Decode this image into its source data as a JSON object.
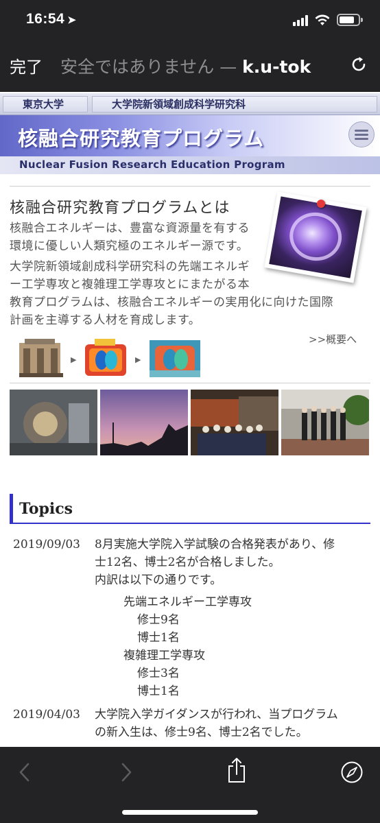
{
  "status": {
    "time": "16:54",
    "location_icon": "location-arrow-icon"
  },
  "browser": {
    "done_label": "完了",
    "url_prefix": "安全ではありません — ",
    "url_host": "k.u-tok",
    "reload_icon": "reload-icon"
  },
  "banner": {
    "univ": "東京大学",
    "grad_school": "大学院新領域創成科学研究科",
    "title": "核融合研究教育プログラム",
    "subtitle": "Nuclear Fusion Research Education Program",
    "menu_icon": "hamburger-icon"
  },
  "about": {
    "title": "核融合研究教育プログラムとは",
    "p1_lines": [
      "核融合エネルギーは、豊富な資源量を有する",
      "環境に優しい人類究極のエネルギー源です。"
    ],
    "p2_lines": [
      "大学院新領域創成科学研究科の先端エネルギ",
      "ー工学専攻と複雑理工学専攻とにまたがる本",
      "教育プログラムは、核融合エネルギーの実用化に向けた国際",
      "計画を主導する人材を育成します。"
    ],
    "link": ">>概要へ"
  },
  "topics": {
    "heading": "Topics",
    "items": [
      {
        "date": "2019/09/03",
        "text_lines": [
          "8月実施大学院入学試験の合格発表があり、修",
          "士12名、博士2名が合格しました。",
          "内訳は以下の通りです。"
        ],
        "breakdown": [
          {
            "dept": "先端エネルギー工学専攻",
            "masters": "修士9名",
            "doctors": "博士1名"
          },
          {
            "dept": "複雑理工学専攻",
            "masters": "修士3名",
            "doctors": "博士1名"
          }
        ]
      },
      {
        "date": "2019/04/03",
        "text_lines": [
          "大学院入学ガイダンスが行われ、当プログラム",
          "の新入生は、修士9名、博士2名でした。"
        ]
      }
    ]
  },
  "toolbar": {
    "back_icon": "back-chevron-icon",
    "forward_icon": "forward-chevron-icon",
    "share_icon": "share-icon",
    "compass_icon": "compass-icon"
  }
}
